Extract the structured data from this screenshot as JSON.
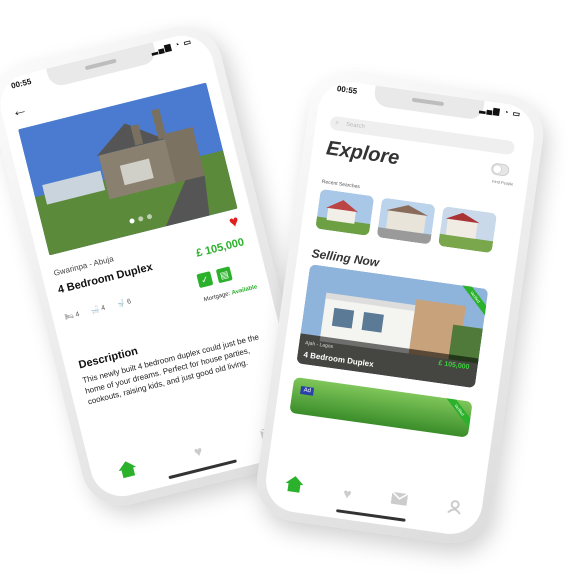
{
  "detail_screen": {
    "status_time": "00:55",
    "location": "Gwarinpa - Abuja",
    "title": "4 Bedroom Duplex",
    "price": "£ 105,000",
    "bedrooms": "4",
    "bathrooms": "4",
    "toilets": "6",
    "mortgage_label": "Mortgage:",
    "mortgage_value": "Available",
    "description_heading": "Description",
    "description_text": "This newly built 4 bedroom duplex could just be the home of your dreams. Perfect for house parties, cookouts, raising kids, and just good old living."
  },
  "explore_screen": {
    "status_time": "00:55",
    "search_placeholder": "Search",
    "title": "Explore",
    "find_people_label": "Find People",
    "recent_searches_label": "Recent Searches",
    "selling_now_label": "Selling Now",
    "listing": {
      "location": "Ajah - Lagos",
      "title": "4 Bedroom Duplex",
      "price": "£ 105,000",
      "badge": "Verified"
    },
    "ad_label": "Ad",
    "ad_badge": "Verified"
  },
  "colors": {
    "accent_green": "#2bb12b",
    "heart_red": "#e02020",
    "ad_blue": "#2a3fa8"
  },
  "icons": {
    "tabbar": [
      "home-icon",
      "heart-icon",
      "mail-icon",
      "profile-icon"
    ]
  }
}
